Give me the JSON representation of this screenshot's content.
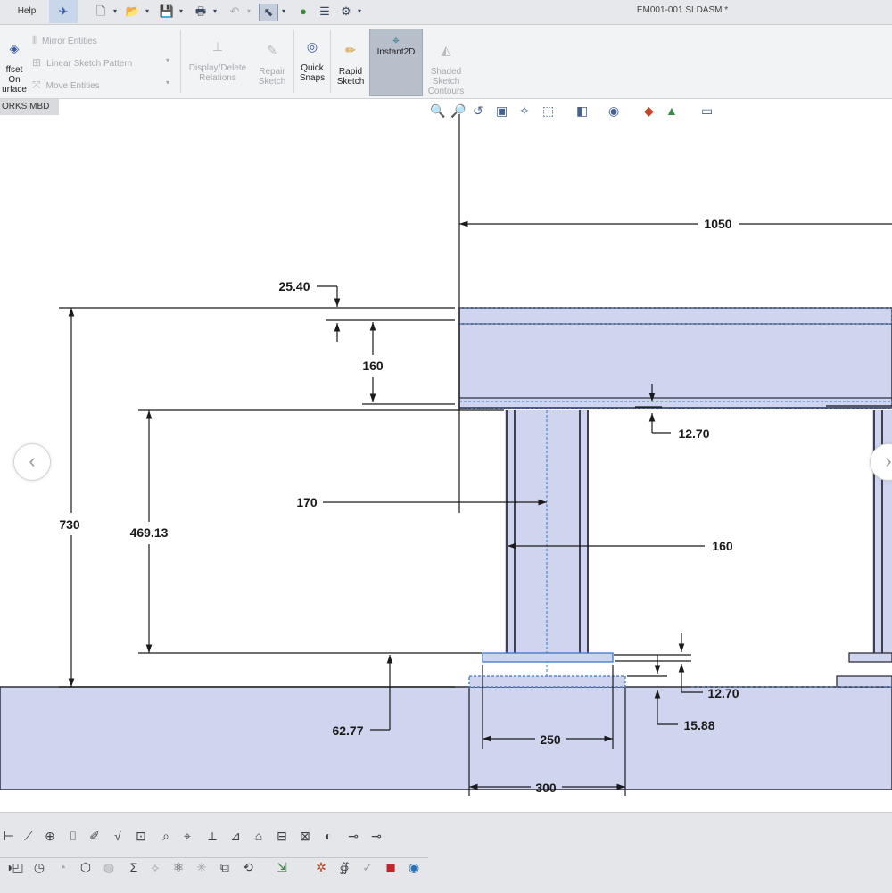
{
  "menu": {
    "help": "Help"
  },
  "window": {
    "title": "EM001-001.SLDASM *"
  },
  "ribbon": {
    "offset_on_surface": "ffset\nOn\nurface",
    "mirror_entities": "Mirror Entities",
    "linear_sketch_pattern": "Linear Sketch Pattern",
    "move_entities": "Move Entities",
    "display_delete_relations": "Display/Delete\nRelations",
    "repair_sketch": "Repair\nSketch",
    "quick_snaps": "Quick\nSnaps",
    "rapid_sketch": "Rapid\nSketch",
    "instant2d": "Instant2D",
    "shaded_sketch_contours": "Shaded\nSketch\nContours"
  },
  "command_tab": {
    "label": "ORKS MBD"
  },
  "dimensions": {
    "d1050": "1050",
    "d25_40": "25.40",
    "d160_vertical": "160",
    "d12_70_top": "12.70",
    "d730": "730",
    "d469_13": "469.13",
    "d170": "170",
    "d160_web": "160",
    "d12_70_bottom": "12.70",
    "d62_77": "62.77",
    "d15_88": "15.88",
    "d250": "250",
    "d300": "300"
  },
  "navigation": {
    "prev": "‹",
    "next": "›"
  },
  "colors": {
    "part_fill": "#cfd5ee",
    "part_edge": "#2f2f3d",
    "selection": "#3d78c8",
    "dimension": "#1a1a1a"
  },
  "icons": {
    "quick_access": [
      "new-document-icon",
      "open-icon",
      "save-icon",
      "print-icon",
      "undo-icon",
      "select-icon",
      "traffic-light-icon",
      "file-properties-icon",
      "options-gear-icon"
    ],
    "heads_up": [
      "zoom-to-fit-icon",
      "zoom-area-icon",
      "previous-view-icon",
      "section-view-icon",
      "dynamic-annotation-icon",
      "view-orientation-icon",
      "display-style-icon",
      "hide-show-icon",
      "edit-appearance-icon",
      "apply-scene-icon",
      "view-settings-icon"
    ]
  }
}
